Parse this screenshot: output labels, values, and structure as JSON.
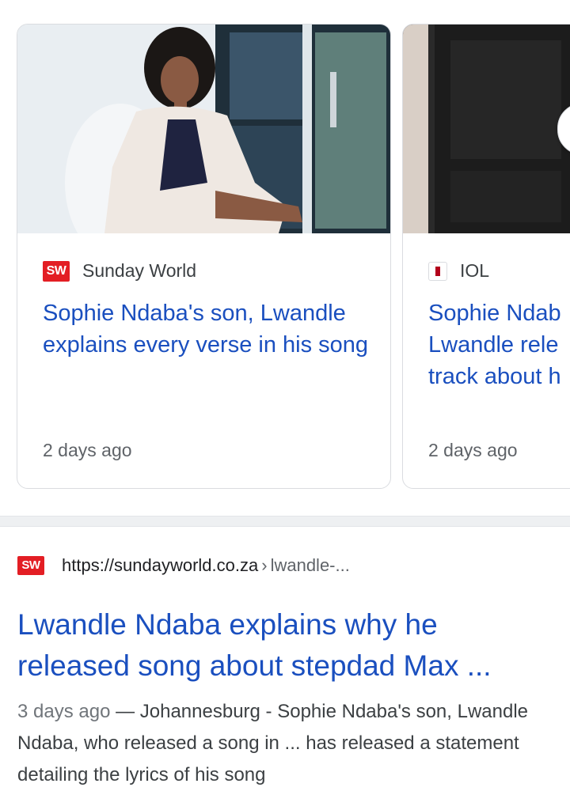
{
  "top_stories": [
    {
      "source": "Sunday World",
      "source_logo": "SW",
      "title": "Sophie Ndaba's son, Lwandle explains every verse in his song",
      "time": "2 days ago"
    },
    {
      "source": "IOL",
      "source_logo": "iol-logo-icon",
      "title_lines": [
        "Sophie Ndab",
        "Lwandle rele",
        "track about h"
      ],
      "time": "2 days ago"
    }
  ],
  "result": {
    "favicon": "SW",
    "url": "https://sundayworld.co.za",
    "separator": "›",
    "path": "lwandle-...",
    "title": "Lwandle Ndaba explains why he released song about stepdad Max ...",
    "date": "3 days ago",
    "dash": " — ",
    "snippet": "Johannesburg - Sophie Ndaba's son, Lwandle Ndaba, who released a song in ... has released a statement detailing the lyrics of his song"
  },
  "colors": {
    "link": "#1a4fbf",
    "brand_red": "#e31e24",
    "border": "#dadce0"
  }
}
